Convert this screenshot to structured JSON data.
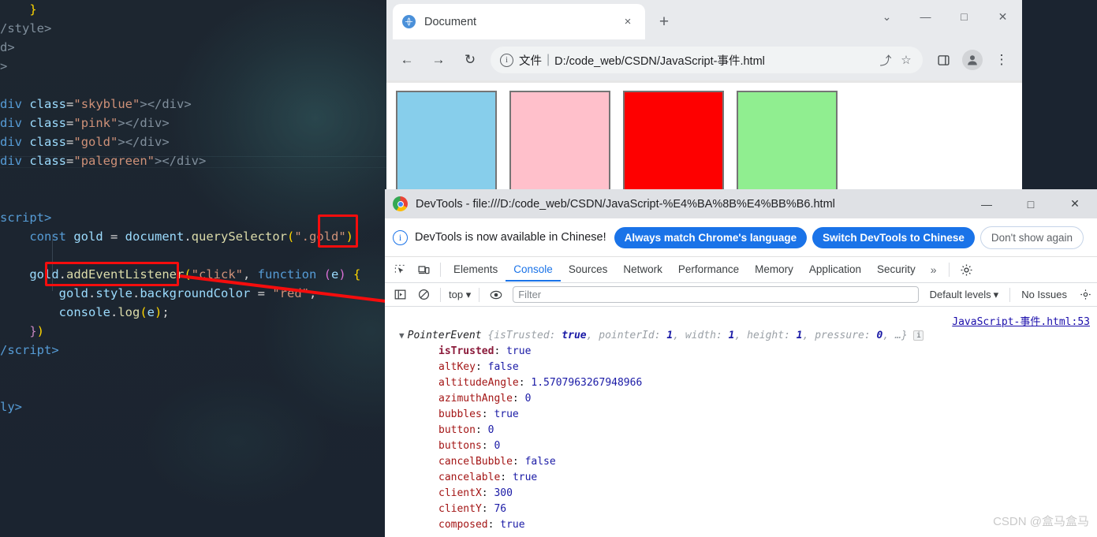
{
  "editor": {
    "lines": [
      {
        "id": "l1",
        "segments": [
          {
            "t": "    }",
            "c": "par"
          }
        ]
      },
      {
        "id": "l2",
        "segments": [
          {
            "t": "/style>",
            "c": "tagp"
          }
        ]
      },
      {
        "id": "l3",
        "segments": [
          {
            "t": "d>",
            "c": "tagp"
          }
        ]
      },
      {
        "id": "l4",
        "segments": [
          {
            "t": ">",
            "c": "tagp"
          }
        ]
      },
      {
        "id": "l5",
        "segments": []
      },
      {
        "id": "l6",
        "segments": [
          {
            "t": "div",
            "c": "tag"
          },
          {
            "t": " ",
            "c": "pun"
          },
          {
            "t": "class",
            "c": "attr"
          },
          {
            "t": "=",
            "c": "pun"
          },
          {
            "t": "\"skyblue\"",
            "c": "str"
          },
          {
            "t": "></div>",
            "c": "tagp"
          }
        ]
      },
      {
        "id": "l7",
        "segments": [
          {
            "t": "div",
            "c": "tag"
          },
          {
            "t": " ",
            "c": "pun"
          },
          {
            "t": "class",
            "c": "attr"
          },
          {
            "t": "=",
            "c": "pun"
          },
          {
            "t": "\"pink\"",
            "c": "str"
          },
          {
            "t": "></div>",
            "c": "tagp"
          }
        ]
      },
      {
        "id": "l8",
        "segments": [
          {
            "t": "div",
            "c": "tag"
          },
          {
            "t": " ",
            "c": "pun"
          },
          {
            "t": "class",
            "c": "attr"
          },
          {
            "t": "=",
            "c": "pun"
          },
          {
            "t": "\"gold\"",
            "c": "str"
          },
          {
            "t": "></div>",
            "c": "tagp"
          }
        ]
      },
      {
        "id": "l9",
        "segments": [
          {
            "t": "div",
            "c": "tag"
          },
          {
            "t": " ",
            "c": "pun"
          },
          {
            "t": "class",
            "c": "attr"
          },
          {
            "t": "=",
            "c": "pun"
          },
          {
            "t": "\"palegreen\"",
            "c": "str"
          },
          {
            "t": "></div>",
            "c": "tagp"
          }
        ]
      },
      {
        "id": "l10",
        "segments": []
      },
      {
        "id": "l11",
        "segments": []
      },
      {
        "id": "l12",
        "segments": [
          {
            "t": "script>",
            "c": "tag"
          }
        ]
      },
      {
        "id": "l13",
        "segments": [
          {
            "t": "    ",
            "c": "pun"
          },
          {
            "t": "const",
            "c": "kw"
          },
          {
            "t": " ",
            "c": "pun"
          },
          {
            "t": "gold",
            "c": "var"
          },
          {
            "t": " = ",
            "c": "pun"
          },
          {
            "t": "document",
            "c": "var"
          },
          {
            "t": ".",
            "c": "pun"
          },
          {
            "t": "querySelector",
            "c": "fn"
          },
          {
            "t": "(",
            "c": "par"
          },
          {
            "t": "\".gold\"",
            "c": "str"
          },
          {
            "t": ")",
            "c": "par"
          },
          {
            "t": ";",
            "c": "pun"
          }
        ]
      },
      {
        "id": "l14",
        "segments": []
      },
      {
        "id": "l15",
        "segments": [
          {
            "t": "    ",
            "c": "pun"
          },
          {
            "t": "gold",
            "c": "var"
          },
          {
            "t": ".",
            "c": "pun"
          },
          {
            "t": "addEventListener",
            "c": "fn"
          },
          {
            "t": "(",
            "c": "par"
          },
          {
            "t": "\"click\"",
            "c": "str"
          },
          {
            "t": ", ",
            "c": "pun"
          },
          {
            "t": "function",
            "c": "kw"
          },
          {
            "t": " ",
            "c": "pun"
          },
          {
            "t": "(",
            "c": "par2"
          },
          {
            "t": "e",
            "c": "var"
          },
          {
            "t": ")",
            "c": "par2"
          },
          {
            "t": " ",
            "c": "pun"
          },
          {
            "t": "{",
            "c": "par"
          }
        ]
      },
      {
        "id": "l16",
        "segments": [
          {
            "t": "        ",
            "c": "pun"
          },
          {
            "t": "gold",
            "c": "var"
          },
          {
            "t": ".",
            "c": "pun"
          },
          {
            "t": "style",
            "c": "prop"
          },
          {
            "t": ".",
            "c": "pun"
          },
          {
            "t": "backgroundColor",
            "c": "prop"
          },
          {
            "t": " = ",
            "c": "pun"
          },
          {
            "t": "\"red\"",
            "c": "str"
          },
          {
            "t": ";",
            "c": "pun"
          }
        ]
      },
      {
        "id": "l17",
        "segments": [
          {
            "t": "        ",
            "c": "pun"
          },
          {
            "t": "console",
            "c": "var"
          },
          {
            "t": ".",
            "c": "pun"
          },
          {
            "t": "log",
            "c": "fn"
          },
          {
            "t": "(",
            "c": "par"
          },
          {
            "t": "e",
            "c": "var"
          },
          {
            "t": ")",
            "c": "par"
          },
          {
            "t": ";",
            "c": "pun"
          }
        ]
      },
      {
        "id": "l18",
        "segments": [
          {
            "t": "    ",
            "c": "pun"
          },
          {
            "t": "}",
            "c": "brace"
          },
          {
            "t": ")",
            "c": "par"
          }
        ]
      },
      {
        "id": "l19",
        "segments": [
          {
            "t": "/script>",
            "c": "tag"
          }
        ]
      },
      {
        "id": "l20",
        "segments": []
      },
      {
        "id": "l21",
        "segments": []
      },
      {
        "id": "l22",
        "segments": [
          {
            "t": "ly>",
            "c": "tag"
          }
        ]
      }
    ],
    "annotations": [
      {
        "id": "box-e-param",
        "label": "highlight-event-param"
      },
      {
        "id": "box-console-log",
        "label": "highlight-console-log"
      },
      {
        "id": "arrow",
        "label": "annotation-arrow"
      }
    ],
    "annotation_color": "#f50d0d"
  },
  "browser": {
    "tab": {
      "title": "Document",
      "close_label": "×"
    },
    "new_tab_label": "+",
    "window_controls": {
      "collapse": "⌄",
      "minimize": "—",
      "maximize": "□",
      "close": "✕"
    },
    "nav": {
      "back": "←",
      "forward": "→",
      "reload": "↻"
    },
    "omnibox": {
      "info_icon": "i",
      "scheme_label": "文件",
      "separator": "|",
      "url": "D:/code_web/CSDN/JavaScript-事件.html",
      "share_icon": "⤴",
      "star_icon": "☆",
      "sidepanel_icon": "▫",
      "menu_icon": "⋮"
    },
    "page_boxes": [
      {
        "name": "skyblue",
        "color": "#87ceeb"
      },
      {
        "name": "pink",
        "color": "#ffc0cb"
      },
      {
        "name": "gold",
        "color": "#fe0000"
      },
      {
        "name": "palegreen",
        "color": "#90ee90"
      }
    ],
    "box_border_color": "#757575"
  },
  "devtools": {
    "title": "DevTools - file:///D:/code_web/CSDN/JavaScript-%E4%BA%8B%E4%BB%B6.html",
    "window_controls": {
      "minimize": "—",
      "maximize": "□",
      "close": "✕"
    },
    "banner": {
      "info_icon": "i",
      "message": "DevTools is now available in Chinese!",
      "buttons": [
        {
          "label": "Always match Chrome's language",
          "style": "primary"
        },
        {
          "label": "Switch DevTools to Chinese",
          "style": "primary"
        },
        {
          "label": "Don't show again",
          "style": "outline"
        }
      ]
    },
    "tabs": [
      {
        "label": "Elements",
        "active": false
      },
      {
        "label": "Console",
        "active": true
      },
      {
        "label": "Sources",
        "active": false
      },
      {
        "label": "Network",
        "active": false
      },
      {
        "label": "Performance",
        "active": false
      },
      {
        "label": "Memory",
        "active": false
      },
      {
        "label": "Application",
        "active": false
      },
      {
        "label": "Security",
        "active": false
      }
    ],
    "tabs_overflow_label": "»",
    "toolbar": {
      "context_label": "top",
      "context_caret": "▾",
      "filter_placeholder": "Filter",
      "levels_label": "Default levels",
      "levels_caret": "▾",
      "issues_label": "No Issues"
    },
    "console": {
      "source_link": "JavaScript-事件.html:53",
      "object_name": "PointerEvent",
      "preview_open": "{",
      "preview_close": "}",
      "preview_pairs": [
        {
          "key": "isTrusted",
          "value": "true"
        },
        {
          "key": "pointerId",
          "value": "1"
        },
        {
          "key": "width",
          "value": "1"
        },
        {
          "key": "height",
          "value": "1"
        },
        {
          "key": "pressure",
          "value": "0"
        }
      ],
      "preview_ellipsis": "…",
      "info_badge": "i",
      "disclosure": "▼",
      "properties": [
        {
          "key": "isTrusted",
          "value": "true",
          "own": true,
          "type": "bool"
        },
        {
          "key": "altKey",
          "value": "false",
          "own": false,
          "type": "bool"
        },
        {
          "key": "altitudeAngle",
          "value": "1.5707963267948966",
          "own": false,
          "type": "num"
        },
        {
          "key": "azimuthAngle",
          "value": "0",
          "own": false,
          "type": "num"
        },
        {
          "key": "bubbles",
          "value": "true",
          "own": false,
          "type": "bool"
        },
        {
          "key": "button",
          "value": "0",
          "own": false,
          "type": "num"
        },
        {
          "key": "buttons",
          "value": "0",
          "own": false,
          "type": "num"
        },
        {
          "key": "cancelBubble",
          "value": "false",
          "own": false,
          "type": "bool"
        },
        {
          "key": "cancelable",
          "value": "true",
          "own": false,
          "type": "bool"
        },
        {
          "key": "clientX",
          "value": "300",
          "own": false,
          "type": "num"
        },
        {
          "key": "clientY",
          "value": "76",
          "own": false,
          "type": "num"
        },
        {
          "key": "composed",
          "value": "true",
          "own": false,
          "type": "bool"
        }
      ]
    }
  },
  "watermark": "CSDN @盒马盒马"
}
